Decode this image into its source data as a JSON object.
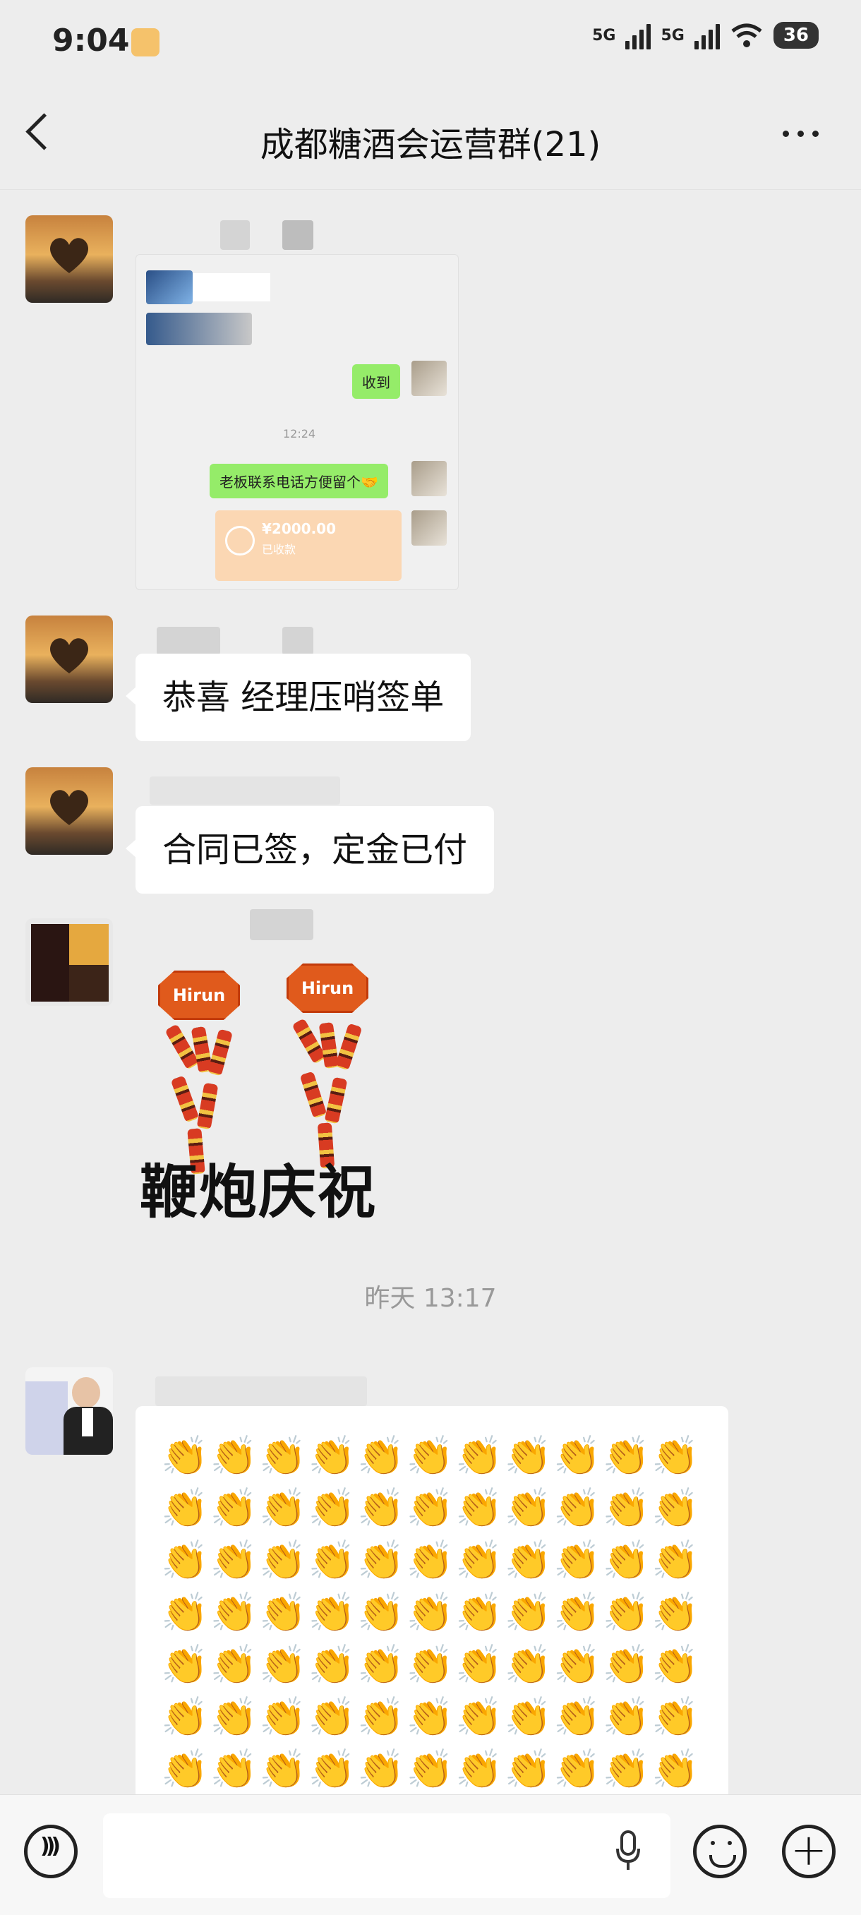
{
  "status_bar": {
    "time": "9:04",
    "network_1": "5G",
    "network_2": "5G",
    "battery": "36"
  },
  "header": {
    "title": "成都糖酒会运营群(21)"
  },
  "screenshot": {
    "reply_1": "收到",
    "time": "12:24",
    "reply_2": "老板联系电话方便留个🤝",
    "transfer_amount": "¥2000.00",
    "transfer_status": "已收款"
  },
  "messages": [
    {
      "text": "恭喜  经理压哨签单"
    },
    {
      "text": "合同已签，定金已付"
    }
  ],
  "sticker": {
    "badge": "Hirun",
    "label": "鞭炮庆祝"
  },
  "timestamp": "昨天 13:17",
  "clap": {
    "emoji": "👏",
    "rows": 7,
    "cols": 11
  }
}
